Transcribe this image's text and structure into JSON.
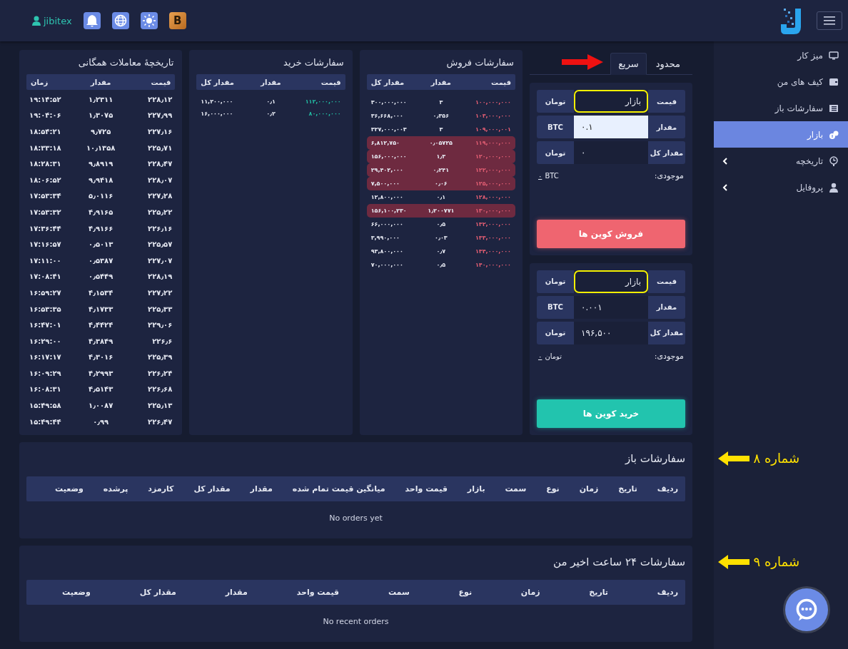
{
  "header": {
    "username": "jibitex",
    "buttons": [
      {
        "kind": "bell"
      },
      {
        "kind": "globe"
      },
      {
        "kind": "sun"
      },
      {
        "kind": "coin",
        "label": "B"
      }
    ]
  },
  "sidebar": {
    "items": [
      {
        "label": "میز کار",
        "selected": false,
        "expandable": false
      },
      {
        "label": "کیف های من",
        "selected": false,
        "expandable": false
      },
      {
        "label": "سفارشات باز",
        "selected": false,
        "expandable": false
      },
      {
        "label": "بازار",
        "selected": true,
        "expandable": false
      },
      {
        "label": "تاریخچه",
        "selected": false,
        "expandable": true
      },
      {
        "label": "پروفایل",
        "selected": false,
        "expandable": true
      }
    ]
  },
  "trade_form": {
    "tabs": [
      {
        "label": "محدود",
        "selected": false
      },
      {
        "label": "سریع",
        "selected": true
      }
    ],
    "panels": [
      {
        "kind": "sell",
        "fields": [
          {
            "label": "قیمت",
            "value": "بازار",
            "unit": "تومان",
            "highlighted": true,
            "focused": false
          },
          {
            "label": "مقدار",
            "value": "۰.۱",
            "unit": "BTC",
            "highlighted": false,
            "focused": true
          },
          {
            "label": "مقدار کل",
            "value": "۰",
            "unit": "تومان",
            "highlighted": false,
            "focused": false
          }
        ],
        "balance_label": "موجودی:",
        "balance_value": "۰",
        "balance_unit": "BTC",
        "button": "فروش کوین ها"
      },
      {
        "kind": "buy",
        "fields": [
          {
            "label": "قیمت",
            "value": "بازار",
            "unit": "تومان",
            "highlighted": true,
            "focused": false
          },
          {
            "label": "مقدار",
            "value": "۰.۰۰۱",
            "unit": "BTC",
            "highlighted": false,
            "focused": false
          },
          {
            "label": "مقدار کل",
            "value": "۱۹۶,۵۰۰",
            "unit": "تومان",
            "highlighted": false,
            "focused": false
          }
        ],
        "balance_label": "موجودی:",
        "balance_value": "۰",
        "balance_unit": "تومان",
        "button": "خرید کوین ها"
      }
    ]
  },
  "sell_orders": {
    "title": "سفارشات فروش",
    "columns": [
      "قیمت",
      "مقدار",
      "مقدار کل"
    ],
    "rows": [
      {
        "price": "۱۰۰,۰۰۰,۰۰۰",
        "amount": "۳",
        "total": "۳۰۰,۰۰۰,۰۰۰",
        "highlighted": false
      },
      {
        "price": "۱۰۳,۰۰۰,۰۰۰",
        "amount": "۰٫۳۵۶",
        "total": "۳۶,۶۶۸,۰۰۰",
        "highlighted": false
      },
      {
        "price": "۱۰۹,۰۰۰,۰۰۱",
        "amount": "۳",
        "total": "۳۲۷,۰۰۰,۰۰۳",
        "highlighted": false
      },
      {
        "price": "۱۱۹,۰۰۰,۰۰۰",
        "amount": "۰٫۰۵۷۲۵",
        "total": "۶,۸۱۲,۷۵۰",
        "highlighted": true
      },
      {
        "price": "۱۲۰,۰۰۰,۰۰۰",
        "amount": "۱٫۳",
        "total": "۱۵۶,۰۰۰,۰۰۰",
        "highlighted": true
      },
      {
        "price": "۱۲۲,۰۰۰,۰۰۰",
        "amount": "۰٫۲۴۱",
        "total": "۲۹,۴۰۲,۰۰۰",
        "highlighted": true
      },
      {
        "price": "۱۲۵,۰۰۰,۰۰۰",
        "amount": "۰٫۰۶",
        "total": "۷,۵۰۰,۰۰۰",
        "highlighted": true
      },
      {
        "price": "۱۲۸,۰۰۰,۰۰۰",
        "amount": "۰٫۱",
        "total": "۱۲,۸۰۰,۰۰۰",
        "highlighted": false
      },
      {
        "price": "۱۳۰,۰۰۰,۰۰۰",
        "amount": "۱٫۲۰۰۷۷۱",
        "total": "۱۵۶,۱۰۰,۲۳۰",
        "highlighted": true
      },
      {
        "price": "۱۳۲,۰۰۰,۰۰۰",
        "amount": "۰٫۵",
        "total": "۶۶,۰۰۰,۰۰۰",
        "highlighted": false
      },
      {
        "price": "۱۳۳,۰۰۰,۰۰۰",
        "amount": "۰٫۰۳",
        "total": "۳,۹۹۰,۰۰۰",
        "highlighted": false
      },
      {
        "price": "۱۳۴,۰۰۰,۰۰۰",
        "amount": "۰٫۷",
        "total": "۹۳,۸۰۰,۰۰۰",
        "highlighted": false
      },
      {
        "price": "۱۴۰,۰۰۰,۰۰۰",
        "amount": "۰٫۵",
        "total": "۷۰,۰۰۰,۰۰۰",
        "highlighted": false
      }
    ]
  },
  "buy_orders": {
    "title": "سفارشات خرید",
    "columns": [
      "قیمت",
      "مقدار",
      "مقدار کل"
    ],
    "rows": [
      {
        "price": "۱۱۲,۰۰۰,۰۰۰",
        "amount": "۰٫۱",
        "total": "۱۱,۲۰۰,۰۰۰"
      },
      {
        "price": "۸۰,۰۰۰,۰۰۰",
        "amount": "۰٫۲",
        "total": "۱۶,۰۰۰,۰۰۰"
      }
    ]
  },
  "trade_history": {
    "title": "تاریخچهٔ معاملات همگانی",
    "columns": [
      "قیمت",
      "مقدار",
      "زمان"
    ],
    "rows": [
      {
        "price": "۲۲۸٫۱۲",
        "amount": "۱٫۲۳۱۱",
        "time": "۱۹:۱۴:۵۲"
      },
      {
        "price": "۲۲۷٫۹۹",
        "amount": "۱٫۳۰۷۵",
        "time": "۱۹:۰۴:۰۶"
      },
      {
        "price": "۲۲۷٫۱۶",
        "amount": "۹٫۷۲۵",
        "time": "۱۸:۵۴:۲۱"
      },
      {
        "price": "۲۲۵٫۷۱",
        "amount": "۱۰٫۱۳۵۸",
        "time": "۱۸:۳۳:۱۸"
      },
      {
        "price": "۲۲۸٫۴۷",
        "amount": "۹٫۸۹۱۹",
        "time": "۱۸:۲۸:۳۱"
      },
      {
        "price": "۲۲۸٫۰۷",
        "amount": "۹٫۹۴۱۸",
        "time": "۱۸:۰۶:۵۲"
      },
      {
        "price": "۲۲۷٫۲۸",
        "amount": "۵٫۰۱۱۶",
        "time": "۱۷:۵۳:۳۴"
      },
      {
        "price": "۲۲۵٫۲۲",
        "amount": "۴٫۹۱۶۵",
        "time": "۱۷:۵۳:۳۲"
      },
      {
        "price": "۲۲۶٫۱۶",
        "amount": "۴٫۹۱۶۶",
        "time": "۱۷:۳۶:۴۴"
      },
      {
        "price": "۲۲۵٫۵۷",
        "amount": "۰٫۵۰۱۳",
        "time": "۱۷:۱۶:۵۷"
      },
      {
        "price": "۲۲۷٫۰۷",
        "amount": "۰٫۵۳۸۷",
        "time": "۱۷:۱۱:۰۰"
      },
      {
        "price": "۲۲۸٫۱۹",
        "amount": "۰٫۵۴۴۹",
        "time": "۱۷:۰۸:۴۱"
      },
      {
        "price": "۲۲۷٫۲۲",
        "amount": "۴٫۱۵۳۴",
        "time": "۱۶:۵۹:۲۷"
      },
      {
        "price": "۲۲۵٫۳۳",
        "amount": "۴٫۱۷۳۳",
        "time": "۱۶:۵۳:۳۵"
      },
      {
        "price": "۲۲۹٫۰۶",
        "amount": "۴٫۴۴۲۴",
        "time": "۱۶:۴۷:۰۱"
      },
      {
        "price": "۲۲۶٫۶",
        "amount": "۴٫۳۸۴۹",
        "time": "۱۶:۲۹:۰۰"
      },
      {
        "price": "۲۲۵٫۳۹",
        "amount": "۴٫۳۰۱۶",
        "time": "۱۶:۱۷:۱۷"
      },
      {
        "price": "۲۲۶٫۲۴",
        "amount": "۴٫۲۹۹۳",
        "time": "۱۶:۰۹:۲۹"
      },
      {
        "price": "۲۲۶٫۶۸",
        "amount": "۴٫۵۱۴۳",
        "time": "۱۶:۰۸:۳۱"
      },
      {
        "price": "۲۲۵٫۱۳",
        "amount": "۱٫۰۰۸۷",
        "time": "۱۵:۴۹:۵۸"
      },
      {
        "price": "۲۲۶٫۴۷",
        "amount": "۰٫۹۹",
        "time": "۱۵:۴۹:۴۴"
      }
    ]
  },
  "open_orders": {
    "title": "سفارشات باز",
    "columns": [
      "ردیف",
      "تاریخ",
      "زمان",
      "نوع",
      "سمت",
      "بازار",
      "قیمت واحد",
      "میانگین قیمت تمام شده",
      "مقدار",
      "مقدار کل",
      "کارمزد",
      "پرشده",
      "وضعیت"
    ],
    "empty_text": "No orders yet",
    "annotation": "شماره ۸"
  },
  "recent_orders": {
    "title": "سفارشات ۲۴ ساعت اخیر من",
    "columns": [
      "ردیف",
      "تاریخ",
      "زمان",
      "نوع",
      "سمت",
      "قیمت واحد",
      "مقدار",
      "مقدار کل",
      "وضعیت"
    ],
    "empty_text": "No recent orders",
    "annotation": "شماره ۹"
  }
}
